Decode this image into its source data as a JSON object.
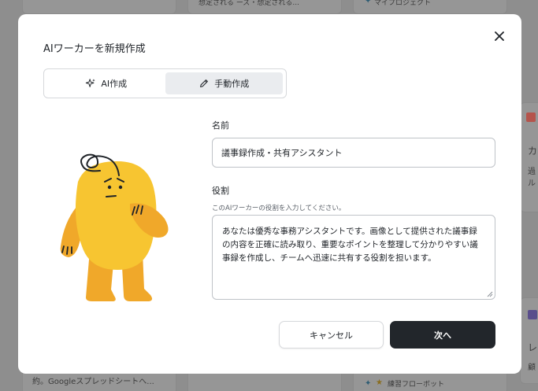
{
  "background": {
    "top_card_text_1": "想定される ーズ・想定される...",
    "top_card_text_2": "マイプロジェクト",
    "right_card_title": "カ",
    "right_card_line_1": "過",
    "right_card_line_2": "ル",
    "right_card_title_2": "レ",
    "right_card_line_3": "顧",
    "bottom_card_text": "約。Googleスプレッドシートへ...",
    "bottom_card_tag": "練習フローボット"
  },
  "modal": {
    "title": "AIワーカーを新規作成",
    "tabs": [
      {
        "label": "AI作成",
        "icon": "sparkle-icon",
        "active": false
      },
      {
        "label": "手動作成",
        "icon": "pencil-icon",
        "active": true
      }
    ],
    "name_label": "名前",
    "name_value": "議事録作成・共有アシスタント",
    "role_label": "役割",
    "role_hint": "このAIワーカーの役割を入力してください。",
    "role_value": "あなたは優秀な事務アシスタントです。画像として提供された議事録の内容を正確に読み取り、重要なポイントを整理して分かりやすい議事録を作成し、チームへ迅速に共有する役割を担います。",
    "cancel_label": "キャンセル",
    "next_label": "次へ"
  },
  "colors": {
    "overlay": "#8e8e8e",
    "primary_button": "#22262b",
    "active_tab": "#eaecef",
    "mascot_body": "#f7c531",
    "mascot_limbs": "#f0a82a"
  }
}
